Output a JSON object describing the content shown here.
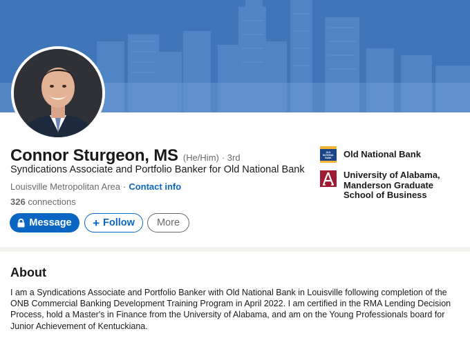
{
  "profile": {
    "name": "Connor Sturgeon, MS",
    "pronouns": "(He/Him)",
    "degree": "· 3rd",
    "headline": "Syndications Associate and Portfolio Banker for Old National Bank",
    "location": "Louisville Metropolitan Area",
    "separator": "·",
    "contact_info": "Contact info",
    "connections_count": "326",
    "connections_label": "connections"
  },
  "actions": {
    "message": "Message",
    "follow": "Follow",
    "more": "More"
  },
  "experience": [
    {
      "name": "Old National Bank",
      "logo": "old-national-bank-logo",
      "logo_text": "OLD NATIONAL BANK"
    },
    {
      "name": "University of Alabama, Manderson Graduate School of Business",
      "logo": "alabama-a-logo"
    }
  ],
  "about": {
    "title": "About",
    "text": "I am a Syndications Associate and Portfolio Banker with Old National Bank in Louisville following completion of the ONB Commercial Banking Development Training Program in April 2022. I am certified in the RMA Lending Decision Process, hold a Master's in Finance from the University of Alabama, and am on the Young Professionals board for Junior Achievement of Kentuckiana."
  },
  "colors": {
    "banner": "#3a6fb3",
    "link": "#0a66c2",
    "alabama": "#9e1b32",
    "onb_yellow": "#f5b335",
    "onb_blue": "#1c4587"
  }
}
